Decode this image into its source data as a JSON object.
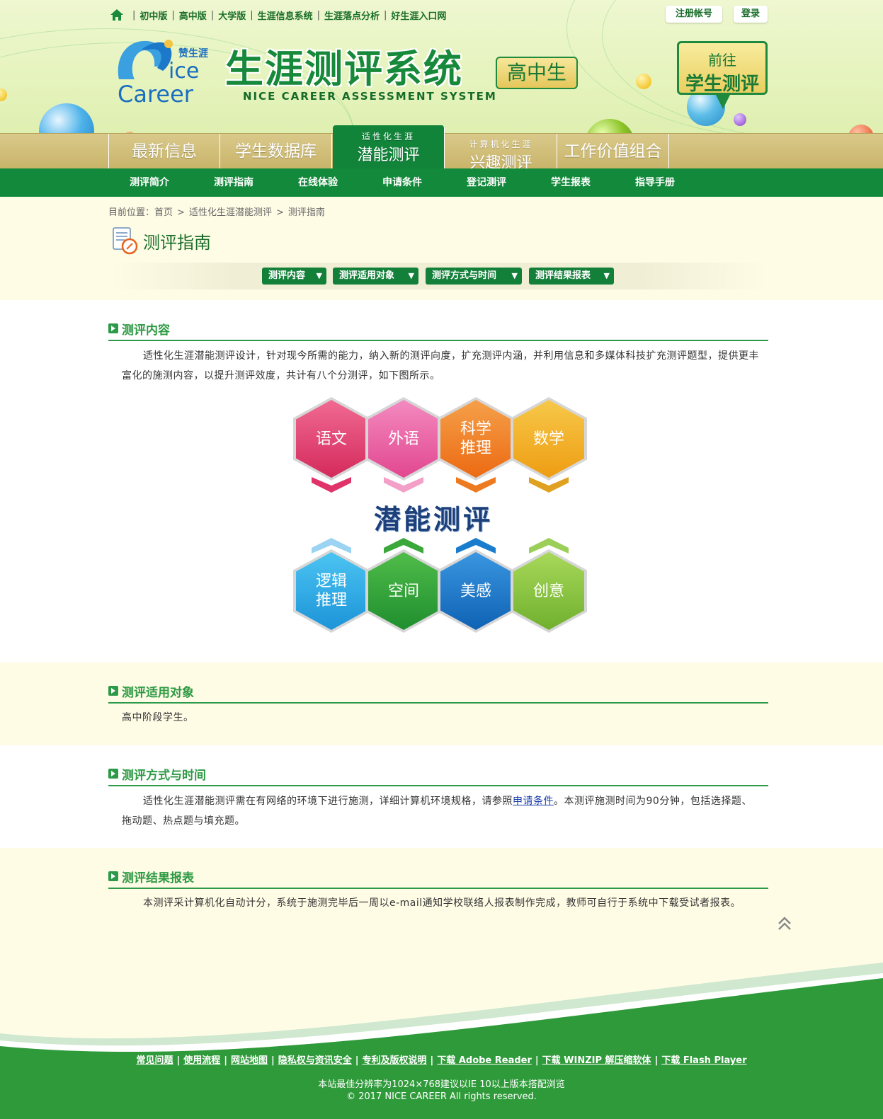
{
  "topnav": {
    "links": [
      "初中版",
      "高中版",
      "大学版",
      "生涯信息系统",
      "生涯落点分析",
      "好生涯入口网"
    ],
    "register": "注册帐号",
    "login": "登录"
  },
  "brand": {
    "logo_cn": "赞生涯",
    "logo_en_1": "ice",
    "logo_en_2": "Career",
    "title": "生涯测评系统",
    "subtitle": "NICE CAREER ASSESSMENT SYSTEM",
    "level": "高中生",
    "goto_line1": "前往",
    "goto_line2": "学生测评"
  },
  "main_tabs": [
    {
      "label": "最新信息"
    },
    {
      "label": "学生数据库"
    },
    {
      "small": "适性化生涯",
      "label": "潜能测评",
      "active": true
    },
    {
      "small": "计算机化生涯",
      "label": "兴趣测评"
    },
    {
      "label": "工作价值组合"
    }
  ],
  "subnav": [
    "测评简介",
    "测评指南",
    "在线体验",
    "申请条件",
    "登记测评",
    "学生报表",
    "指导手册"
  ],
  "breadcrumb": {
    "prefix": "目前位置：",
    "items": [
      "首页",
      "适性化生涯潜能测评",
      "测评指南"
    ]
  },
  "page": {
    "title": "测评指南",
    "anchors": [
      "测评内容",
      "测评适用对象",
      "测评方式与时间",
      "测评结果报表"
    ]
  },
  "sections": {
    "content": {
      "title": "测评内容",
      "text": "适性化生涯潜能测评设计，针对现今所需的能力，纳入新的测评向度，扩充测评内涵，并利用信息和多媒体科技扩充测评题型，提供更丰富化的施测内容，以提升测评效度，共计有八个分测评，如下图所示。"
    },
    "target": {
      "title": "测评适用对象",
      "text": "高中阶段学生。"
    },
    "method": {
      "title": "测评方式与时间",
      "text_before": "适性化生涯潜能测评需在有网络的环境下进行施测，详细计算机环境规格，请参照",
      "link": "申请条件",
      "text_after": "。本测评施测时间为90分钟，包括选择题、拖动题、热点题与填充题。"
    },
    "report": {
      "title": "测评结果报表",
      "text": "本测评采计算机化自动计分，系统于施测完毕后一周以e-mail通知学校联络人报表制作完成，教师可自行于系统中下载受试者报表。"
    }
  },
  "diagram": {
    "center": "潜能测评",
    "top": [
      {
        "line1": "语文",
        "line2": "",
        "color": "#e0336a"
      },
      {
        "line1": "外语",
        "line2": "",
        "color": "#ee5aa0"
      },
      {
        "line1": "科学",
        "line2": "推理",
        "color": "#f07a1e"
      },
      {
        "line1": "数学",
        "line2": "",
        "color": "#f2b21c"
      }
    ],
    "bottom": [
      {
        "line1": "逻辑",
        "line2": "推理",
        "color": "#2aa9e6"
      },
      {
        "line1": "空间",
        "line2": "",
        "color": "#2fa33a"
      },
      {
        "line1": "美感",
        "line2": "",
        "color": "#1876c9"
      },
      {
        "line1": "创意",
        "line2": "",
        "color": "#8cc43c"
      }
    ]
  },
  "footer": {
    "links": [
      "常见问题",
      "使用流程",
      "网站地图",
      "隐私权与资讯安全",
      "专利及版权说明",
      "下载 Adobe Reader",
      "下载 WINZIP 解压缩软体",
      "下载 Flash Player"
    ],
    "resolution": "本站最佳分辨率为1024×768建议以IE 10以上版本搭配浏览",
    "copyright": "© 2017 NICE CAREER All rights reserved."
  },
  "colors": {
    "primary_green": "#13893b",
    "tab_gold": "#c9b46a",
    "page_bg": "#fffce6"
  }
}
